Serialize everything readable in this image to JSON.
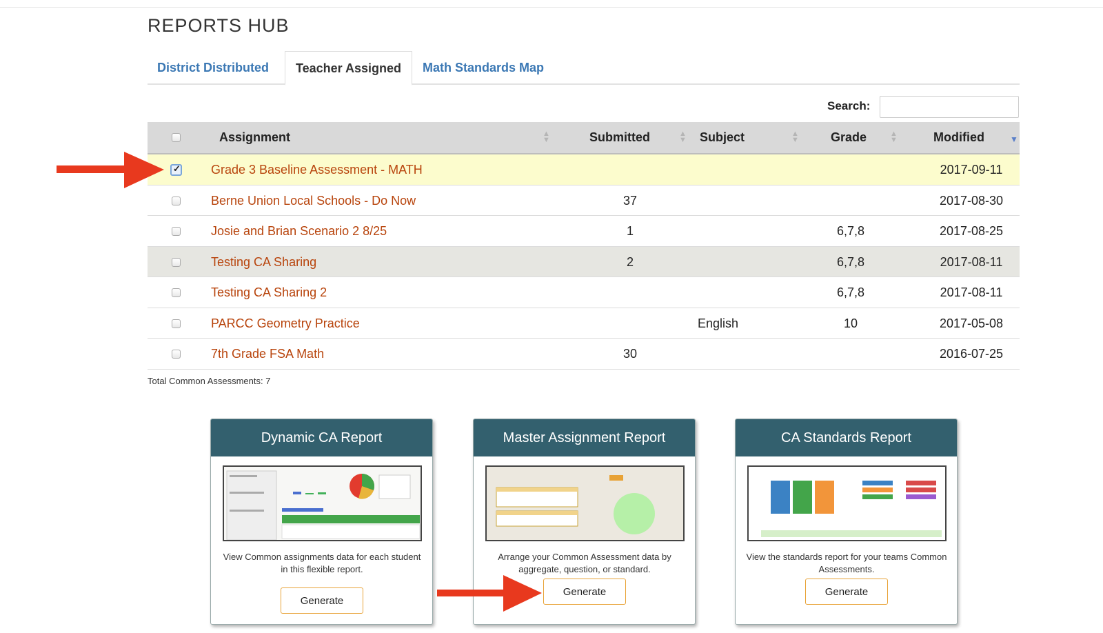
{
  "page": {
    "title": "REPORTS HUB"
  },
  "tabs": [
    {
      "label": "District Distributed",
      "active": false
    },
    {
      "label": "Teacher Assigned",
      "active": true
    },
    {
      "label": "Math Standards Map",
      "active": false
    }
  ],
  "search": {
    "label": "Search:",
    "value": ""
  },
  "table": {
    "headers": {
      "assignment": "Assignment",
      "submitted": "Submitted",
      "subject": "Subject",
      "grade": "Grade",
      "modified": "Modified"
    },
    "rows": [
      {
        "checked": true,
        "assignment": "Grade 3 Baseline Assessment - MATH",
        "submitted": "",
        "subject": "",
        "grade": "",
        "modified": "2017-09-11"
      },
      {
        "checked": false,
        "assignment": "Berne Union Local Schools - Do Now",
        "submitted": "37",
        "subject": "",
        "grade": "",
        "modified": "2017-08-30"
      },
      {
        "checked": false,
        "assignment": "Josie and Brian Scenario 2 8/25",
        "submitted": "1",
        "subject": "",
        "grade": "6,7,8",
        "modified": "2017-08-25"
      },
      {
        "checked": false,
        "assignment": "Testing CA Sharing",
        "submitted": "2",
        "subject": "",
        "grade": "6,7,8",
        "modified": "2017-08-11"
      },
      {
        "checked": false,
        "assignment": "Testing CA Sharing 2",
        "submitted": "",
        "subject": "",
        "grade": "6,7,8",
        "modified": "2017-08-11"
      },
      {
        "checked": false,
        "assignment": "PARCC Geometry Practice",
        "submitted": "",
        "subject": "English",
        "grade": "10",
        "modified": "2017-05-08"
      },
      {
        "checked": false,
        "assignment": "7th Grade FSA Math",
        "submitted": "30",
        "subject": "",
        "grade": "",
        "modified": "2016-07-25"
      }
    ],
    "total": "Total Common Assessments: 7"
  },
  "cards": [
    {
      "title": "Dynamic CA Report",
      "description": "View Common assignments data for each student in this flexible report.",
      "button": "Generate"
    },
    {
      "title": "Master Assignment Report",
      "description": "Arrange your Common Assessment data by aggregate, question, or standard.",
      "button": "Generate"
    },
    {
      "title": "CA Standards Report",
      "description": "View the standards report for your teams Common Assessments.",
      "button": "Generate"
    }
  ],
  "colors": {
    "link": "#b8440c",
    "tab_link": "#3b78b4",
    "card_header": "#33606e",
    "button_border": "#e8a236",
    "highlight_row": "#fcfccd",
    "annotation_arrow": "#e8391e"
  }
}
